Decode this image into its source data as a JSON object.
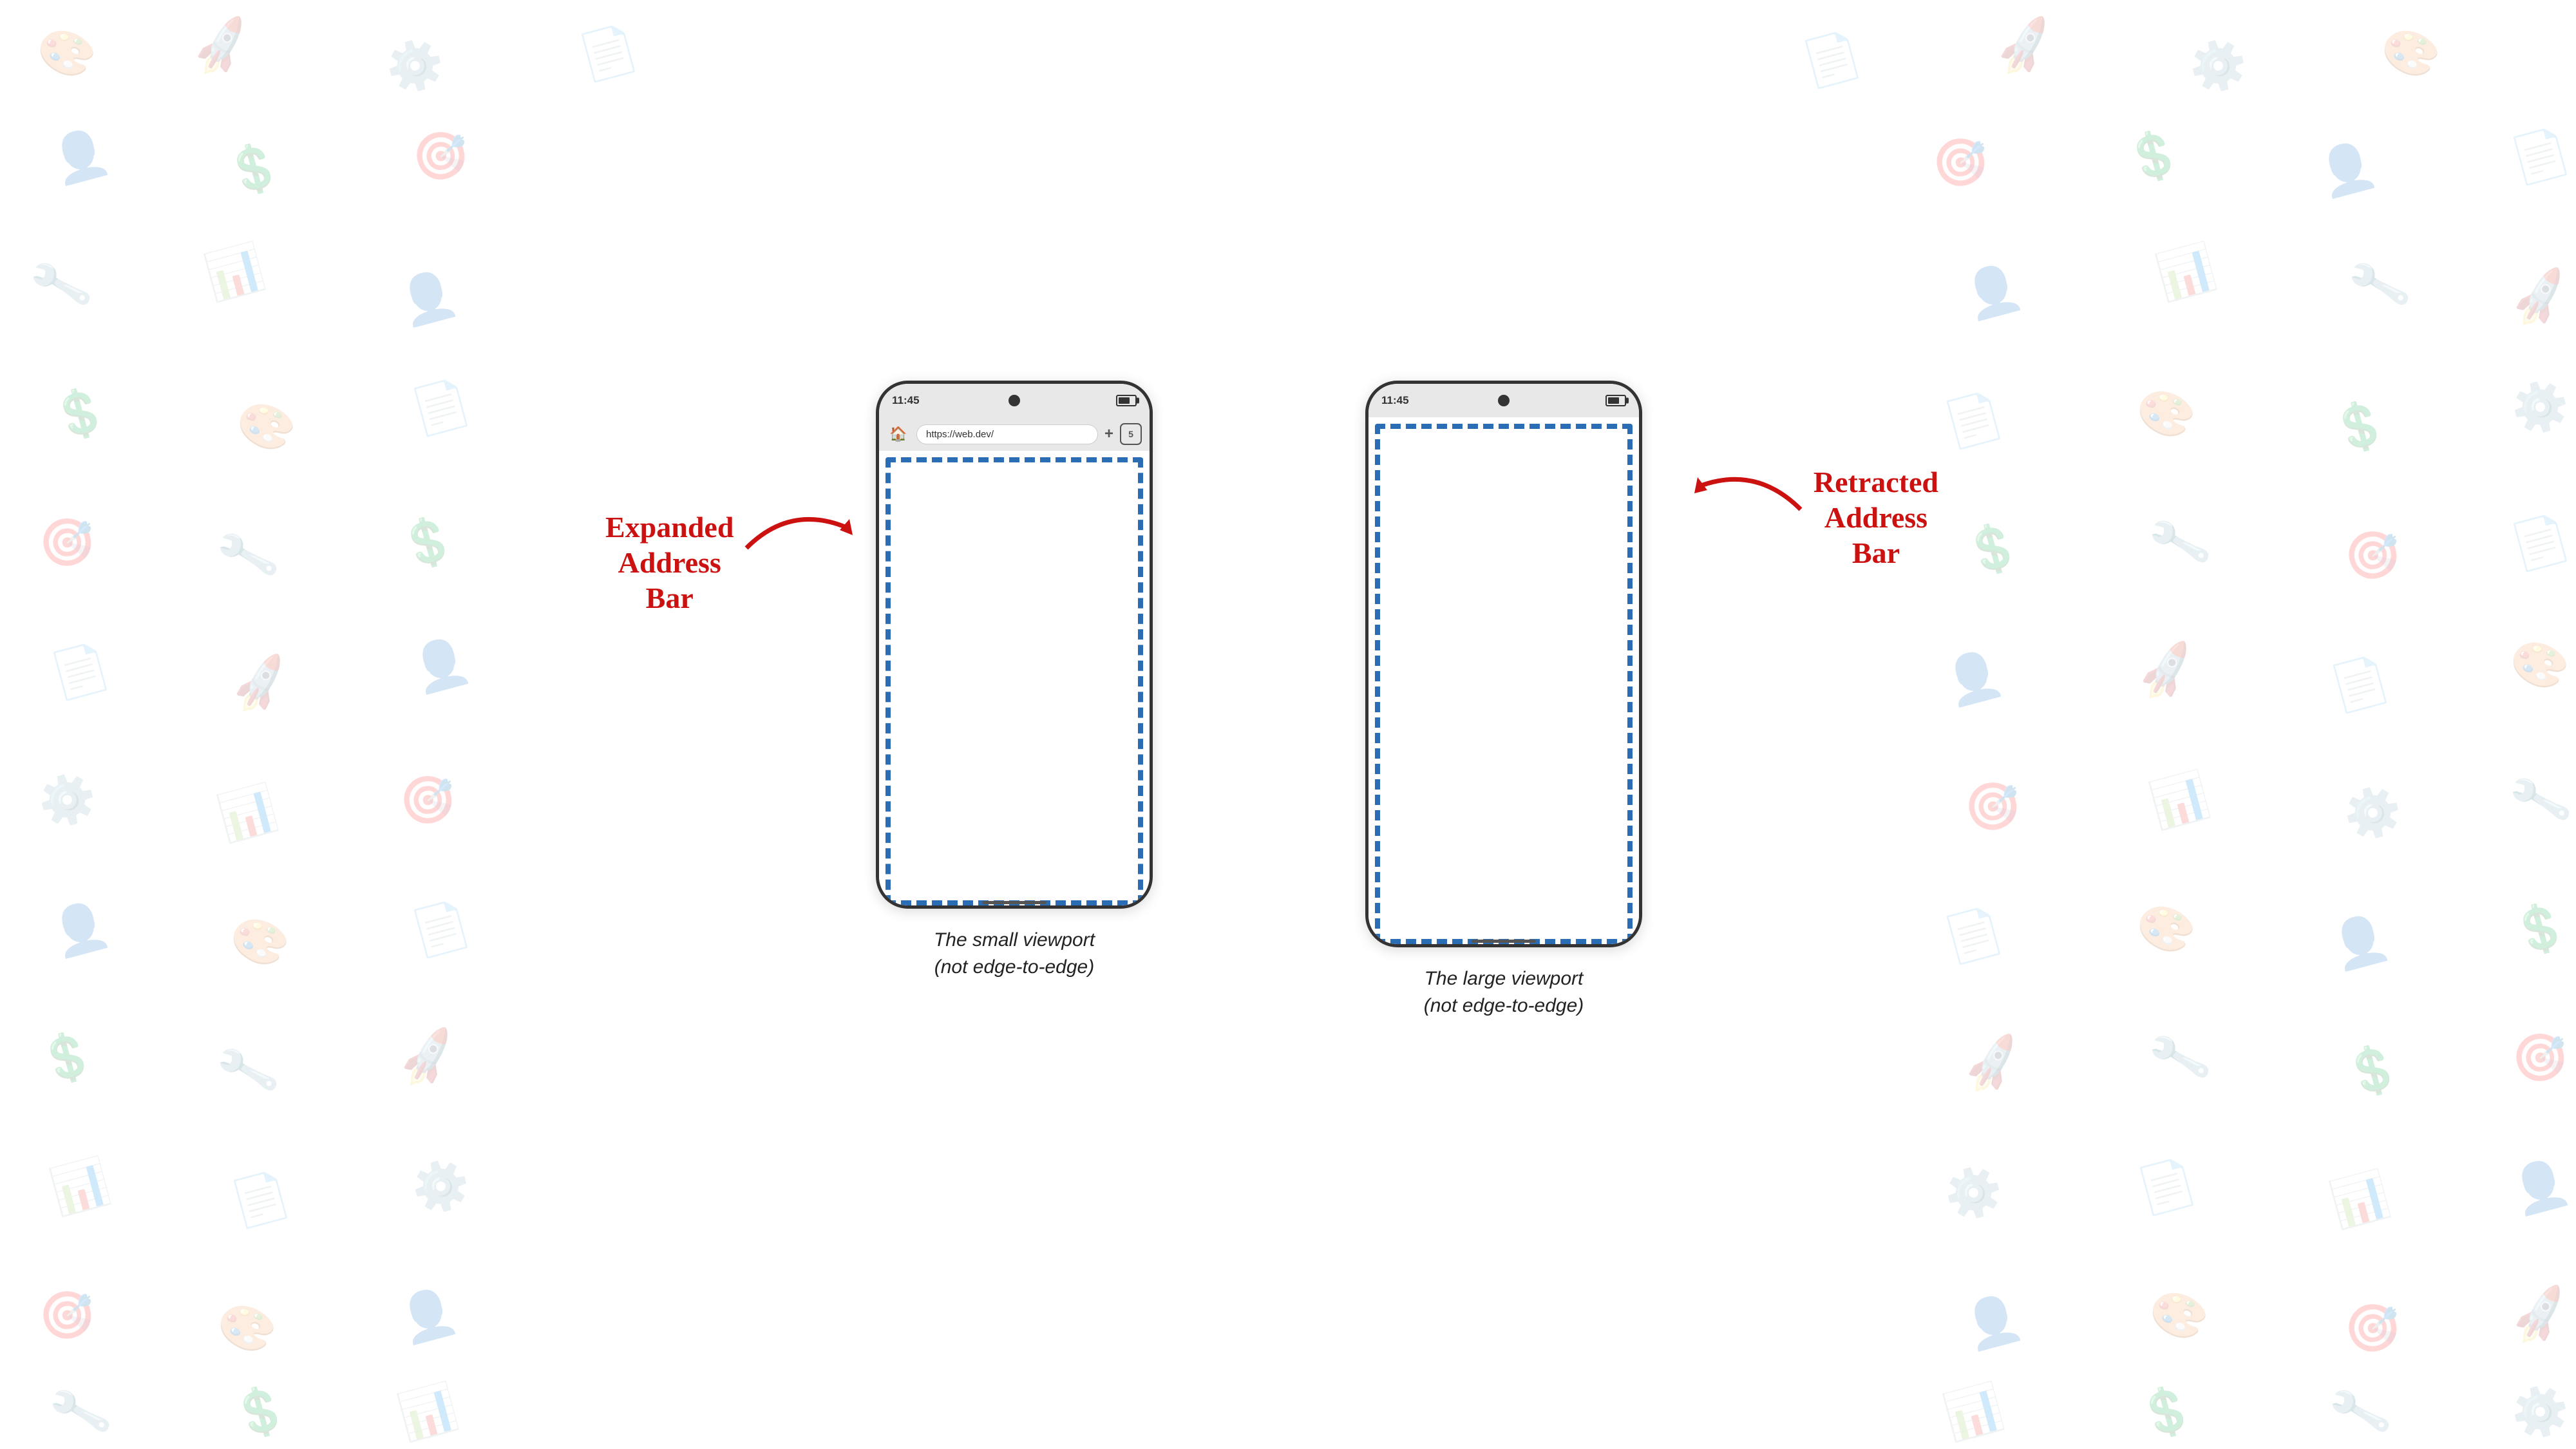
{
  "background": {
    "color": "#ffffff"
  },
  "left_phone": {
    "status_bar": {
      "time": "11:45",
      "camera_visible": true,
      "battery_visible": true
    },
    "address_bar": {
      "url": "https://web.dev/",
      "plus_label": "+",
      "tab_count": "5"
    },
    "has_address_bar": true,
    "viewport_label": "small viewport",
    "caption_line1": "The small viewport",
    "caption_line2": "(not edge-to-edge)"
  },
  "right_phone": {
    "status_bar": {
      "time": "11:45",
      "camera_visible": true,
      "battery_visible": true
    },
    "has_address_bar": false,
    "viewport_label": "large viewport",
    "caption_line1": "The large viewport",
    "caption_line2": "(not edge-to-edge)"
  },
  "labels": {
    "expanded": {
      "line1": "Expanded",
      "line2": "Address",
      "line3": "Bar"
    },
    "retracted": {
      "line1": "Retracted",
      "line2": "Address",
      "line3": "Bar"
    }
  },
  "dashed_border_color": "#2a6db5"
}
